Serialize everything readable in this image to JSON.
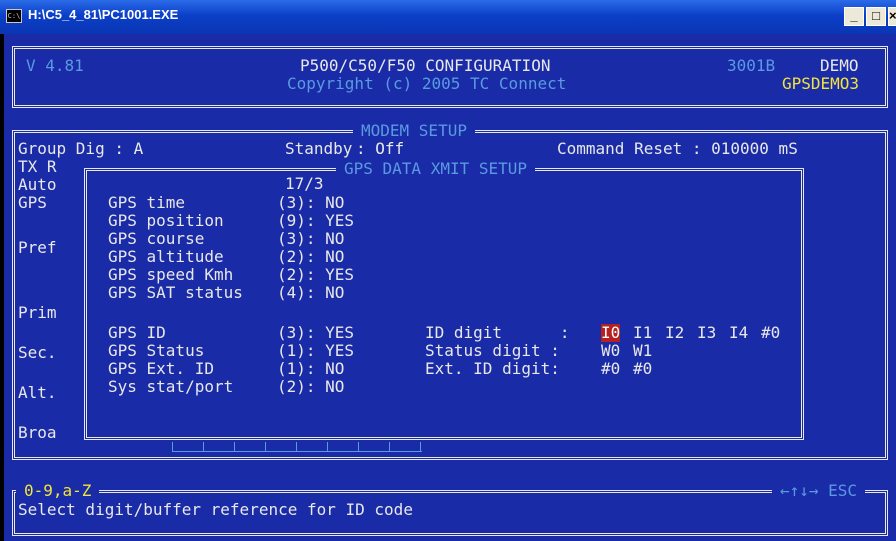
{
  "window": {
    "title": "H:\\C5_4_81\\PC1001.EXE",
    "icon": "cmd-icon",
    "icon_glyph": "C:\\"
  },
  "header": {
    "version": "V 4.81",
    "title": "P500/C50/F50 CONFIGURATION",
    "copyright": "Copyright (c) 2005 TC Connect",
    "code": "3001B",
    "mode": "DEMO",
    "device": "GPSDEMO3"
  },
  "modem": {
    "title": "MODEM SETUP",
    "group_dig": "Group Dig : A",
    "standby": "Standby",
    "standby_value": ": Off",
    "command_reset": "Command Reset : 010000 mS",
    "side_labels": [
      "TX R",
      "Auto",
      "GPS",
      "Pref",
      "Prim",
      "Sec.",
      "Alt.",
      "Broa"
    ]
  },
  "gps": {
    "title": "GPS DATA XMIT SETUP",
    "counter": "17/3",
    "items": [
      {
        "label": "GPS time",
        "value": "(3): NO"
      },
      {
        "label": "GPS position",
        "value": "(9): YES"
      },
      {
        "label": "GPS course",
        "value": "(3): NO"
      },
      {
        "label": "GPS altitude",
        "value": "(2): NO"
      },
      {
        "label": "GPS speed Kmh",
        "value": "(2): YES"
      },
      {
        "label": "GPS SAT status",
        "value": "(4): NO"
      },
      {
        "label": "GPS ID",
        "value": "(3): YES"
      },
      {
        "label": "GPS Status",
        "value": "(1): YES"
      },
      {
        "label": "GPS Ext. ID",
        "value": "(1): NO"
      },
      {
        "label": "Sys stat/port",
        "value": "(2): NO"
      }
    ],
    "id_digit_label": "ID digit      :",
    "id_digit_options": [
      "I0",
      "I1",
      "I2",
      "I3",
      "I4",
      "#0"
    ],
    "status_digit_label": "Status digit :",
    "status_digit_options": [
      "W0",
      "W1"
    ],
    "ext_id_digit_label": "Ext. ID digit:",
    "ext_id_digit_options": [
      "#0",
      "#0"
    ]
  },
  "footer": {
    "keys": "0-9,a-Z",
    "nav_keys": "←↑↓→ ESC",
    "help": "Select digit/buffer reference for ID code"
  },
  "colors": {
    "background": "#1a2ba8",
    "text": "#e8e8e8",
    "accent": "#5a9ae0",
    "highlight": "#f2e43a",
    "selection": "#b52020"
  }
}
